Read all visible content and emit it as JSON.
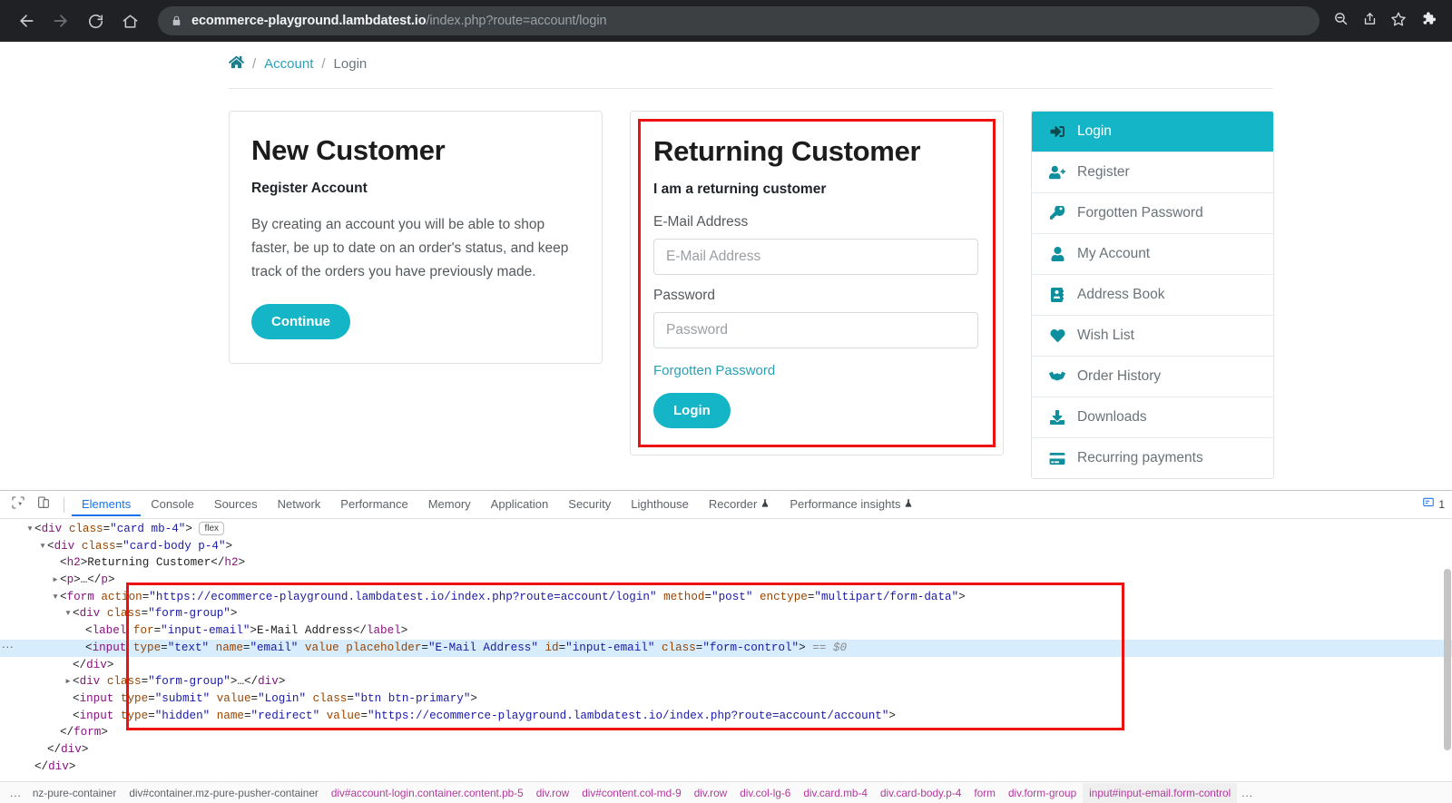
{
  "browser": {
    "url_domain": "ecommerce-playground.lambdatest.io",
    "url_path": "/index.php?route=account/login",
    "icons": {
      "back": "back-arrow-icon",
      "forward": "forward-arrow-icon",
      "reload": "reload-icon",
      "home": "home-icon",
      "lock": "lock-icon",
      "zoom": "zoom-search-icon",
      "share": "share-icon",
      "bookmark": "bookmark-star-icon",
      "extensions": "puzzle-extension-icon"
    }
  },
  "page": {
    "breadcrumb": {
      "home_icon": "home-icon",
      "account": "Account",
      "current": "Login",
      "separator": "/"
    },
    "new_customer": {
      "title": "New Customer",
      "subtitle": "Register Account",
      "description": "By creating an account you will be able to shop faster, be up to date on an order's status, and keep track of the orders you have previously made.",
      "button": "Continue"
    },
    "returning_customer": {
      "title": "Returning Customer",
      "subtitle": "I am a returning customer",
      "email_label": "E-Mail Address",
      "email_placeholder": "E-Mail Address",
      "email_value": "",
      "password_label": "Password",
      "password_placeholder": "Password",
      "password_value": "",
      "forgot_link": "Forgotten Password",
      "button": "Login",
      "highlight_color": "#ee1111"
    },
    "side_nav": [
      {
        "label": "Login",
        "icon": "sign-in-icon",
        "active": true
      },
      {
        "label": "Register",
        "icon": "user-plus-icon",
        "active": false
      },
      {
        "label": "Forgotten Password",
        "icon": "key-icon",
        "active": false
      },
      {
        "label": "My Account",
        "icon": "user-icon",
        "active": false
      },
      {
        "label": "Address Book",
        "icon": "address-book-icon",
        "active": false
      },
      {
        "label": "Wish List",
        "icon": "heart-icon",
        "active": false
      },
      {
        "label": "Order History",
        "icon": "box-open-icon",
        "active": false
      },
      {
        "label": "Downloads",
        "icon": "download-icon",
        "active": false
      },
      {
        "label": "Recurring payments",
        "icon": "credit-card-icon",
        "active": false
      }
    ],
    "accent_color": "#13b5c6"
  },
  "devtools": {
    "tool_icons": {
      "inspect": "inspect-element-icon",
      "device": "device-toolbar-icon",
      "messages": "message-count-icon"
    },
    "tabs": [
      {
        "label": "Elements",
        "active": true
      },
      {
        "label": "Console",
        "active": false
      },
      {
        "label": "Sources",
        "active": false
      },
      {
        "label": "Network",
        "active": false
      },
      {
        "label": "Performance",
        "active": false
      },
      {
        "label": "Memory",
        "active": false
      },
      {
        "label": "Application",
        "active": false
      },
      {
        "label": "Security",
        "active": false
      },
      {
        "label": "Lighthouse",
        "active": false
      },
      {
        "label": "Recorder",
        "active": false,
        "badge": "experiment-flask-icon"
      },
      {
        "label": "Performance insights",
        "active": false,
        "badge": "experiment-flask-icon"
      }
    ],
    "message_count": "1",
    "dom_lines": [
      {
        "indent": 3,
        "twisty": "down",
        "html": "<span class=\"punc\">&lt;</span><span class=\"tag\">div</span> <span class=\"attr\">class</span><span class=\"punc\">=</span><span class=\"val\">\"card mb-4\"</span><span class=\"punc\">&gt;</span> <span class=\"flexbadge\">flex</span>"
      },
      {
        "indent": 4,
        "twisty": "down",
        "html": "<span class=\"punc\">&lt;</span><span class=\"tag\">div</span> <span class=\"attr\">class</span><span class=\"punc\">=</span><span class=\"val\">\"card-body p-4\"</span><span class=\"punc\">&gt;</span>"
      },
      {
        "indent": 5,
        "twisty": "none",
        "html": "<span class=\"punc\">&lt;</span><span class=\"tag\">h2</span><span class=\"punc\">&gt;</span><span class=\"txt\">Returning Customer</span><span class=\"punc\">&lt;/</span><span class=\"tag\">h2</span><span class=\"punc\">&gt;</span>"
      },
      {
        "indent": 5,
        "twisty": "right",
        "html": "<span class=\"punc\">&lt;</span><span class=\"tag\">p</span><span class=\"punc\">&gt;</span><span class=\"txt\">…</span><span class=\"punc\">&lt;/</span><span class=\"tag\">p</span><span class=\"punc\">&gt;</span>"
      },
      {
        "indent": 5,
        "twisty": "down",
        "html": "<span class=\"punc\">&lt;</span><span class=\"tag\">form</span> <span class=\"attr\">action</span><span class=\"punc\">=</span><span class=\"val\">\"https://ecommerce-playground.lambdatest.io/index.php?route=account/login\"</span> <span class=\"attr\">method</span><span class=\"punc\">=</span><span class=\"val\">\"post\"</span> <span class=\"attr\">enctype</span><span class=\"punc\">=</span><span class=\"val\">\"multipart/form-data\"</span><span class=\"punc\">&gt;</span>"
      },
      {
        "indent": 6,
        "twisty": "down",
        "html": "<span class=\"punc\">&lt;</span><span class=\"tag\">div</span> <span class=\"attr\">class</span><span class=\"punc\">=</span><span class=\"val\">\"form-group\"</span><span class=\"punc\">&gt;</span>"
      },
      {
        "indent": 7,
        "twisty": "none",
        "html": "<span class=\"punc\">&lt;</span><span class=\"tag\">label</span> <span class=\"attr\">for</span><span class=\"punc\">=</span><span class=\"val\">\"input-email\"</span><span class=\"punc\">&gt;</span><span class=\"txt\">E-Mail Address</span><span class=\"punc\">&lt;/</span><span class=\"tag\">label</span><span class=\"punc\">&gt;</span>"
      },
      {
        "indent": 7,
        "twisty": "none",
        "selected": true,
        "html": "<span class=\"punc\">&lt;</span><span class=\"tag\">input</span> <span class=\"attr\">type</span><span class=\"punc\">=</span><span class=\"val\">\"text\"</span> <span class=\"attr\">name</span><span class=\"punc\">=</span><span class=\"val\">\"email\"</span> <span class=\"attr\">value</span> <span class=\"attr\">placeholder</span><span class=\"punc\">=</span><span class=\"val\">\"E-Mail Address\"</span> <span class=\"attr\">id</span><span class=\"punc\">=</span><span class=\"val\">\"input-email\"</span> <span class=\"attr\">class</span><span class=\"punc\">=</span><span class=\"val\">\"form-control\"</span><span class=\"punc\">&gt;</span> <span class=\"eqsel\">== $0</span>"
      },
      {
        "indent": 6,
        "twisty": "none",
        "html": "<span class=\"punc\">&lt;/</span><span class=\"tag\">div</span><span class=\"punc\">&gt;</span>"
      },
      {
        "indent": 6,
        "twisty": "right",
        "html": "<span class=\"punc\">&lt;</span><span class=\"tag\">div</span> <span class=\"attr\">class</span><span class=\"punc\">=</span><span class=\"val\">\"form-group\"</span><span class=\"punc\">&gt;</span><span class=\"txt\">…</span><span class=\"punc\">&lt;/</span><span class=\"tag\">div</span><span class=\"punc\">&gt;</span>"
      },
      {
        "indent": 6,
        "twisty": "none",
        "html": "<span class=\"punc\">&lt;</span><span class=\"tag\">input</span> <span class=\"attr\">type</span><span class=\"punc\">=</span><span class=\"val\">\"submit\"</span> <span class=\"attr\">value</span><span class=\"punc\">=</span><span class=\"val\">\"Login\"</span> <span class=\"attr\">class</span><span class=\"punc\">=</span><span class=\"val\">\"btn btn-primary\"</span><span class=\"punc\">&gt;</span>"
      },
      {
        "indent": 6,
        "twisty": "none",
        "html": "<span class=\"punc\">&lt;</span><span class=\"tag\">input</span> <span class=\"attr\">type</span><span class=\"punc\">=</span><span class=\"val\">\"hidden\"</span> <span class=\"attr\">name</span><span class=\"punc\">=</span><span class=\"val\">\"redirect\"</span> <span class=\"attr\">value</span><span class=\"punc\">=</span><span class=\"val\">\"https://ecommerce-playground.lambdatest.io/index.php?route=account/account\"</span><span class=\"punc\">&gt;</span>"
      },
      {
        "indent": 5,
        "twisty": "none",
        "html": "<span class=\"punc\">&lt;/</span><span class=\"tag\">form</span><span class=\"punc\">&gt;</span>"
      },
      {
        "indent": 4,
        "twisty": "none",
        "html": "<span class=\"punc\">&lt;/</span><span class=\"tag\">div</span><span class=\"punc\">&gt;</span>"
      },
      {
        "indent": 3,
        "twisty": "none",
        "html": "<span class=\"punc\">&lt;/</span><span class=\"tag\">div</span><span class=\"punc\">&gt;</span>"
      }
    ],
    "breadcrumbs": [
      {
        "label": "nz-pure-container",
        "style": "dim"
      },
      {
        "label": "div#container.mz-pure-pusher-container",
        "style": "dim"
      },
      {
        "label": "div#account-login.container.content.pb-5",
        "style": "normal"
      },
      {
        "label": "div.row",
        "style": "normal"
      },
      {
        "label": "div#content.col-md-9",
        "style": "normal"
      },
      {
        "label": "div.row",
        "style": "normal"
      },
      {
        "label": "div.col-lg-6",
        "style": "normal"
      },
      {
        "label": "div.card.mb-4",
        "style": "normal"
      },
      {
        "label": "div.card-body.p-4",
        "style": "normal"
      },
      {
        "label": "form",
        "style": "normal"
      },
      {
        "label": "div.form-group",
        "style": "normal"
      },
      {
        "label": "input#input-email.form-control",
        "style": "last"
      }
    ]
  }
}
